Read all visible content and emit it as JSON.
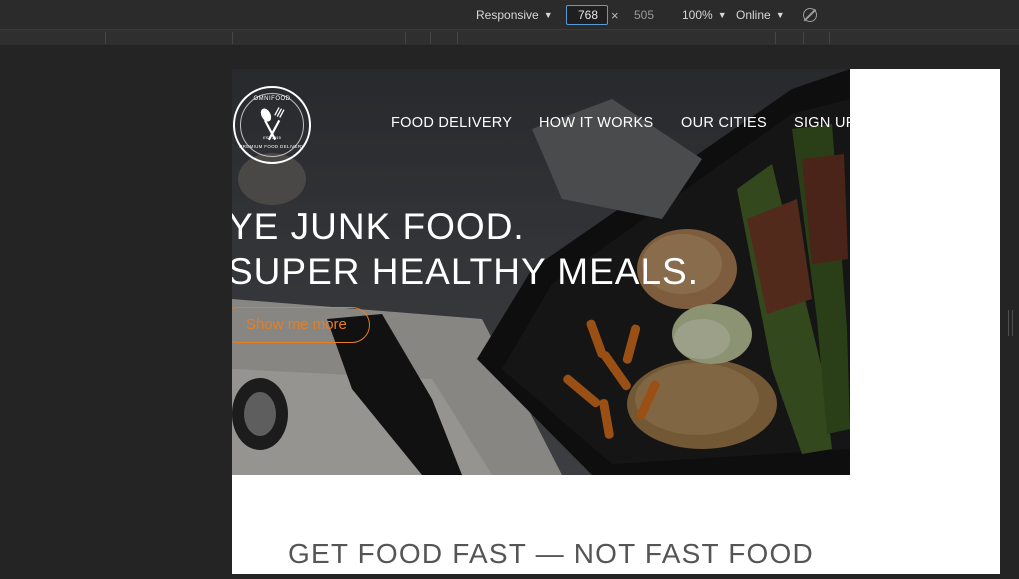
{
  "devtools": {
    "device": "Responsive",
    "width_value": "768",
    "dimension_separator": "×",
    "height": "505",
    "zoom": "100%",
    "network": "Online"
  },
  "site": {
    "logo": {
      "brand": "OMNIFOOD",
      "tagline": "PREMIUM FOOD DELIVERY",
      "established": "EST 2015"
    },
    "nav": [
      "FOOD DELIVERY",
      "HOW IT WORKS",
      "OUR CITIES",
      "SIGN UP"
    ],
    "hero": {
      "title_line_1": "YE JUNK FOOD.",
      "title_line_2": "SUPER HEALTHY MEALS.",
      "cta_label": "Show me more"
    },
    "section_heading": "GET FOOD FAST — NOT FAST FOOD"
  },
  "colors": {
    "accent": "#e67e22",
    "devtools_bg": "#242424",
    "devtools_focus": "#5b9bd5"
  }
}
